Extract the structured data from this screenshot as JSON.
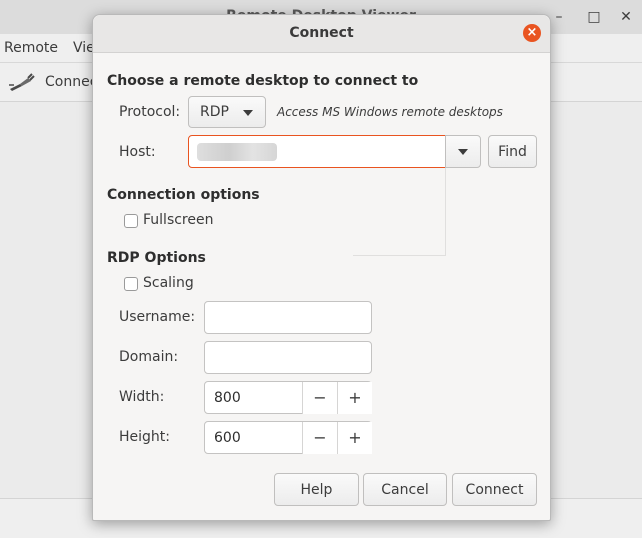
{
  "main_window": {
    "title": "Remote Desktop Viewer",
    "menus": [
      "Remote",
      "View"
    ],
    "toolbar_connect_label": "Connect",
    "window_controls": {
      "minimize": "–",
      "maximize": "□",
      "close": "✕"
    }
  },
  "dialog": {
    "title": "Connect",
    "close_glyph": "×",
    "section_choose": "Choose a remote desktop to connect to",
    "protocol": {
      "label": "Protocol:",
      "value": "RDP",
      "hint": "Access MS Windows remote desktops"
    },
    "host": {
      "label": "Host:",
      "value": "",
      "find_label": "Find"
    },
    "section_connection": "Connection options",
    "fullscreen": {
      "label": "Fullscreen",
      "checked": false
    },
    "section_rdp": "RDP Options",
    "scaling": {
      "label": "Scaling",
      "checked": false
    },
    "username": {
      "label": "Username:",
      "value": ""
    },
    "domain": {
      "label": "Domain:",
      "value": ""
    },
    "width": {
      "label": "Width:",
      "value": "800",
      "minus": "−",
      "plus": "+"
    },
    "height": {
      "label": "Height:",
      "value": "600",
      "minus": "−",
      "plus": "+"
    },
    "buttons": {
      "help": "Help",
      "cancel": "Cancel",
      "connect": "Connect"
    }
  },
  "colors": {
    "accent": "#e95420",
    "dialog_bg": "#f6f5f4",
    "header_bg": "#e8e7e6"
  }
}
